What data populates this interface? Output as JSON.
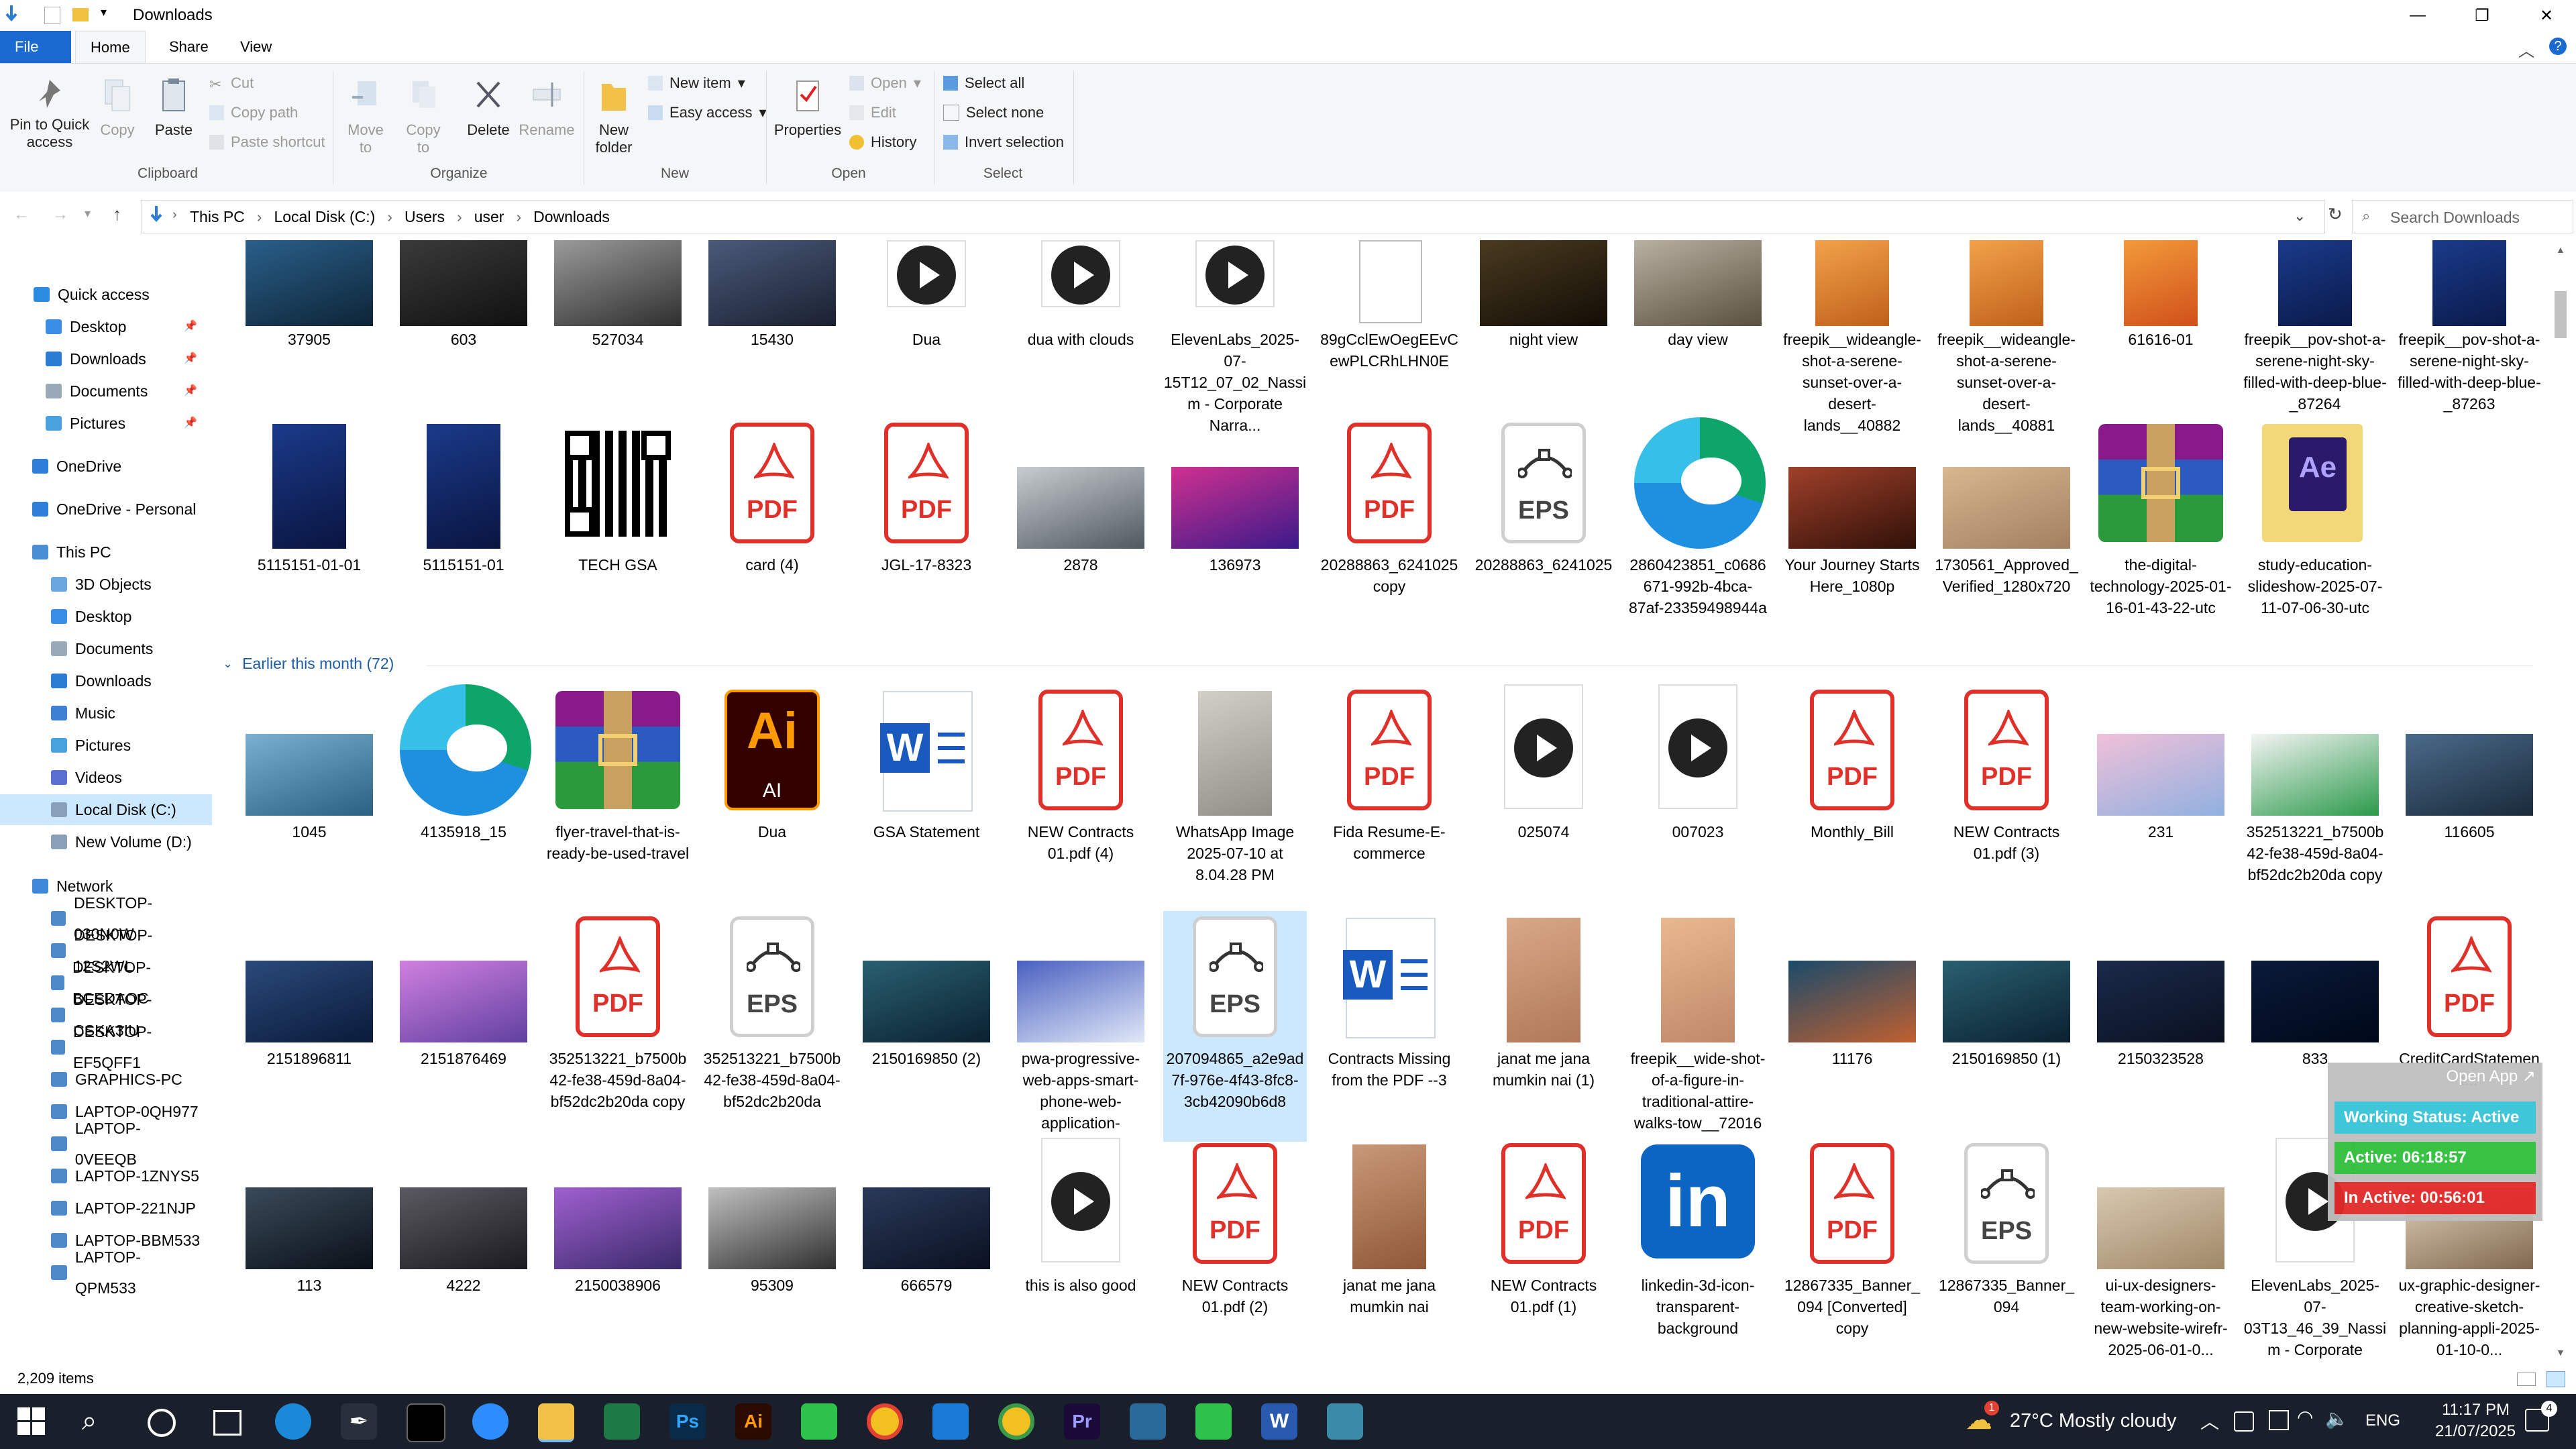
{
  "window": {
    "title": "Downloads",
    "minimize": "—",
    "maximize": "❐",
    "close": "✕"
  },
  "tabs": [
    {
      "label": "File"
    },
    {
      "label": "Home"
    },
    {
      "label": "Share"
    },
    {
      "label": "View"
    }
  ],
  "ribbon": {
    "clipboard": {
      "pin": "Pin to Quick access",
      "copy": "Copy",
      "paste": "Paste",
      "cut": "Cut",
      "copy_path": "Copy path",
      "paste_shortcut": "Paste shortcut",
      "group": "Clipboard"
    },
    "organize": {
      "move_to": "Move to",
      "copy_to": "Copy to",
      "delete": "Delete",
      "rename": "Rename",
      "group": "Organize"
    },
    "new": {
      "new_folder": "New folder",
      "new_item": "New item",
      "easy_access": "Easy access",
      "group": "New"
    },
    "open": {
      "properties": "Properties",
      "open": "Open",
      "edit": "Edit",
      "history": "History",
      "group": "Open"
    },
    "select": {
      "select_all": "Select all",
      "select_none": "Select none",
      "invert": "Invert selection",
      "group": "Select"
    }
  },
  "address": {
    "crumbs": [
      "This PC",
      "Local Disk (C:)",
      "Users",
      "user",
      "Downloads"
    ],
    "search_placeholder": "Search Downloads"
  },
  "nav": [
    {
      "label": "Quick access",
      "color": "#2b8be0"
    },
    {
      "label": "Desktop",
      "color": "#3a8ee6"
    },
    {
      "label": "Downloads",
      "color": "#2b7cd3"
    },
    {
      "label": "Documents",
      "color": "#9aa9b8"
    },
    {
      "label": "Pictures",
      "color": "#4aa3df"
    },
    {
      "label": "OneDrive",
      "color": "#2f7fd8"
    },
    {
      "label": "OneDrive - Personal",
      "color": "#2f7fd8"
    },
    {
      "label": "This PC",
      "color": "#4a8fd6"
    },
    {
      "label": "3D Objects",
      "color": "#6aa7e0"
    },
    {
      "label": "Desktop",
      "color": "#3a8ee6"
    },
    {
      "label": "Documents",
      "color": "#9aa9b8"
    },
    {
      "label": "Downloads",
      "color": "#2b7cd3"
    },
    {
      "label": "Music",
      "color": "#3d7fd0"
    },
    {
      "label": "Pictures",
      "color": "#4aa3df"
    },
    {
      "label": "Videos",
      "color": "#5a6fd0"
    },
    {
      "label": "Local Disk (C:)",
      "color": "#8aa0b8"
    },
    {
      "label": "New Volume (D:)",
      "color": "#8aa0b8"
    },
    {
      "label": "Network",
      "color": "#3f87d8"
    },
    {
      "label": "DESKTOP-030N0W",
      "color": "#4d88c8"
    },
    {
      "label": "DESKTOP-12S2WL",
      "color": "#4d88c8"
    },
    {
      "label": "DESKTOP-BCEDAOC",
      "color": "#4d88c8"
    },
    {
      "label": "DESKTOP-CSKA3IU",
      "color": "#4d88c8"
    },
    {
      "label": "DESKTOP-EF5QFF1",
      "color": "#4d88c8"
    },
    {
      "label": "GRAPHICS-PC",
      "color": "#4d88c8"
    },
    {
      "label": "LAPTOP-0QH977",
      "color": "#4d88c8"
    },
    {
      "label": "LAPTOP-0VEEQB",
      "color": "#4d88c8"
    },
    {
      "label": "LAPTOP-1ZNYS5",
      "color": "#4d88c8"
    },
    {
      "label": "LAPTOP-221NJP",
      "color": "#4d88c8"
    },
    {
      "label": "LAPTOP-BBM533",
      "color": "#4d88c8"
    },
    {
      "label": "LAPTOP-QPM533",
      "color": "#4d88c8"
    }
  ],
  "group_header": "Earlier this month (72)",
  "row1": [
    {
      "name": "37905",
      "kind": "img",
      "c1": "#2a5f8a",
      "c2": "#0d2436"
    },
    {
      "name": "603",
      "kind": "img",
      "c1": "#3a3a3a",
      "c2": "#101010"
    },
    {
      "name": "527034",
      "kind": "img",
      "c1": "#9a9a9a",
      "c2": "#2f2f2f"
    },
    {
      "name": "15430",
      "kind": "img",
      "c1": "#4a5a7a",
      "c2": "#1a2030"
    },
    {
      "name": "Dua",
      "kind": "video"
    },
    {
      "name": "dua with clouds",
      "kind": "video"
    },
    {
      "name": "ElevenLabs_2025-07-15T12_07_02_Nassim - Corporate Narra...",
      "kind": "video"
    },
    {
      "name": "89gCclEwOegEEvCewPLCRhLHN0E",
      "kind": "doc"
    },
    {
      "name": "night view",
      "kind": "img",
      "c1": "#4a3a20",
      "c2": "#120d05"
    },
    {
      "name": "day view",
      "kind": "img",
      "c1": "#b8b0a0",
      "c2": "#5a5040"
    },
    {
      "name": "freepik__wideangle-shot-a-serene-sunset-over-a-desert-lands__40882",
      "kind": "img",
      "c1": "#f2a24a",
      "c2": "#c0601a"
    },
    {
      "name": "freepik__wideangle-shot-a-serene-sunset-over-a-desert-lands__40881",
      "kind": "img",
      "c1": "#f2a24a",
      "c2": "#c0601a"
    },
    {
      "name": "61616-01",
      "kind": "img",
      "c1": "#f29a3a",
      "c2": "#d0501a"
    },
    {
      "name": "freepik__pov-shot-a-serene-night-sky-filled-with-deep-blue-_87264",
      "kind": "img",
      "c1": "#1a3a8a",
      "c2": "#0a1a4a"
    },
    {
      "name": "freepik__pov-shot-a-serene-night-sky-filled-with-deep-blue-_87263",
      "kind": "img",
      "c1": "#1a3a8a",
      "c2": "#0a1a4a"
    }
  ],
  "row2": [
    {
      "name": "5115151-01-01",
      "kind": "img",
      "c1": "#1a3a8a",
      "c2": "#0a1440"
    },
    {
      "name": "5115151-01",
      "kind": "img",
      "c1": "#1a3a8a",
      "c2": "#0a1440"
    },
    {
      "name": "TECH GSA",
      "kind": "qr"
    },
    {
      "name": "card (4)",
      "kind": "pdf"
    },
    {
      "name": "JGL-17-8323",
      "kind": "pdf"
    },
    {
      "name": "2878",
      "kind": "img",
      "c1": "#c8ccd0",
      "c2": "#505860"
    },
    {
      "name": "136973",
      "kind": "img",
      "c1": "#d03090",
      "c2": "#3a1a8a"
    },
    {
      "name": "20288863_6241025 copy",
      "kind": "pdf"
    },
    {
      "name": "20288863_6241025",
      "kind": "eps"
    },
    {
      "name": "2860423851_c0686671-992b-4bca-87af-23359498944a",
      "kind": "edge"
    },
    {
      "name": "Your Journey Starts Here_1080p",
      "kind": "img",
      "c1": "#a0402a",
      "c2": "#301008"
    },
    {
      "name": "1730561_Approved_Verified_1280x720",
      "kind": "img",
      "c1": "#d8b890",
      "c2": "#a08060"
    },
    {
      "name": "the-digital-technology-2025-01-16-01-43-22-utc",
      "kind": "rar"
    },
    {
      "name": "study-education-slideshow-2025-07-11-07-06-30-utc",
      "kind": "folder"
    }
  ],
  "row3": [
    {
      "name": "1045",
      "kind": "img",
      "c1": "#7ab0d0",
      "c2": "#2a6080"
    },
    {
      "name": "4135918_15",
      "kind": "edge"
    },
    {
      "name": "flyer-travel-that-is-ready-be-used-travel",
      "kind": "rar"
    },
    {
      "name": "Dua",
      "kind": "ai"
    },
    {
      "name": "GSA Statement",
      "kind": "word"
    },
    {
      "name": "NEW Contracts 01.pdf (4)",
      "kind": "pdf"
    },
    {
      "name": "WhatsApp Image 2025-07-10 at 8.04.28 PM",
      "kind": "img",
      "c1": "#d0d0c8",
      "c2": "#909088"
    },
    {
      "name": "Fida Resume-E-commerce",
      "kind": "pdf"
    },
    {
      "name": "025074",
      "kind": "video"
    },
    {
      "name": "007023",
      "kind": "video"
    },
    {
      "name": "Monthly_Bill",
      "kind": "pdf"
    },
    {
      "name": "NEW Contracts 01.pdf (3)",
      "kind": "pdf"
    },
    {
      "name": "231",
      "kind": "img",
      "c1": "#f0c0d8",
      "c2": "#90b0e0"
    },
    {
      "name": "352513221_b7500b42-fe38-459d-8a04-bf52dc2b20da copy",
      "kind": "img",
      "c1": "#f4f4f4",
      "c2": "#2a9a4a"
    },
    {
      "name": "116605",
      "kind": "img",
      "c1": "#4a6a8a",
      "c2": "#1a2a3a"
    }
  ],
  "row4": [
    {
      "name": "2151896811",
      "kind": "img",
      "c1": "#2a4a7a",
      "c2": "#0a1a3a"
    },
    {
      "name": "2151876469",
      "kind": "img",
      "c1": "#d080e0",
      "c2": "#6040a0"
    },
    {
      "name": "352513221_b7500b42-fe38-459d-8a04-bf52dc2b20da copy",
      "kind": "pdf"
    },
    {
      "name": "352513221_b7500b42-fe38-459d-8a04-bf52dc2b20da",
      "kind": "eps"
    },
    {
      "name": "2150169850 (2)",
      "kind": "img",
      "c1": "#2a6070",
      "c2": "#0a2030"
    },
    {
      "name": "pwa-progressive-web-apps-smart-phone-web-application-develop...",
      "kind": "img",
      "c1": "#4a60c0",
      "c2": "#e0e8f8"
    },
    {
      "name": "207094865_a2e9ad7f-976e-4f43-8fc8-3cb42090b6d8",
      "kind": "eps",
      "selected": true
    },
    {
      "name": "Contracts Missing from the PDF --3",
      "kind": "word"
    },
    {
      "name": "janat me jana mumkin nai (1)",
      "kind": "img",
      "c1": "#d8a888",
      "c2": "#b07858"
    },
    {
      "name": "freepik__wide-shot-of-a-figure-in-traditional-attire-walks-tow__72016",
      "kind": "img",
      "c1": "#e8b890",
      "c2": "#c08868"
    },
    {
      "name": "11176",
      "kind": "img",
      "c1": "#1a4a6a",
      "c2": "#c06030"
    },
    {
      "name": "2150169850 (1)",
      "kind": "img",
      "c1": "#2a6070",
      "c2": "#0a2030"
    },
    {
      "name": "2150323528",
      "kind": "img",
      "c1": "#1a2a4a",
      "c2": "#0a1020"
    },
    {
      "name": "833",
      "kind": "img",
      "c1": "#0a1a3a",
      "c2": "#000818"
    },
    {
      "name": "CreditCardStatement...",
      "kind": "pdf"
    }
  ],
  "row5": [
    {
      "name": "113",
      "kind": "img",
      "c1": "#3a4a5a",
      "c2": "#0a1018"
    },
    {
      "name": "4222",
      "kind": "img",
      "c1": "#5a5a60",
      "c2": "#1a1a20"
    },
    {
      "name": "2150038906",
      "kind": "img",
      "c1": "#a060d0",
      "c2": "#3a2a6a"
    },
    {
      "name": "95309",
      "kind": "img",
      "c1": "#c0c0c0",
      "c2": "#303030"
    },
    {
      "name": "666579",
      "kind": "img",
      "c1": "#2a3a5a",
      "c2": "#0a1020"
    },
    {
      "name": "this is also good",
      "kind": "video"
    },
    {
      "name": "NEW Contracts 01.pdf (2)",
      "kind": "pdf"
    },
    {
      "name": "janat me jana mumkin nai",
      "kind": "img",
      "c1": "#c89878",
      "c2": "#905838"
    },
    {
      "name": "NEW Contracts 01.pdf (1)",
      "kind": "pdf"
    },
    {
      "name": "linkedin-3d-icon-transparent-background",
      "kind": "linkedin"
    },
    {
      "name": "12867335_Banner_094 [Converted] copy",
      "kind": "pdf"
    },
    {
      "name": "12867335_Banner_094",
      "kind": "eps"
    },
    {
      "name": "ui-ux-designers-team-working-on-new-website-wirefr-2025-06-01-0...",
      "kind": "img",
      "c1": "#d8c8b0",
      "c2": "#a08868"
    },
    {
      "name": "ElevenLabs_2025-07-03T13_46_39_Nassim - Corporate Narra...",
      "kind": "video"
    },
    {
      "name": "ux-graphic-designer-creative-sketch-planning-appli-2025-01-10-0...",
      "kind": "img",
      "c1": "#e0d0b8",
      "c2": "#806850"
    }
  ],
  "overlay": {
    "open_app": "Open App ↗",
    "working": "Working Status: Active",
    "active": "Active: 06:18:57",
    "inactive": "In Active: 00:56:01"
  },
  "status": {
    "items": "2,209 items"
  },
  "taskbar": {
    "weather": "27°C  Mostly cloudy",
    "lang": "ENG",
    "time": "11:17 PM",
    "date": "21/07/2025",
    "weather_badge": "1",
    "notif": "4"
  }
}
